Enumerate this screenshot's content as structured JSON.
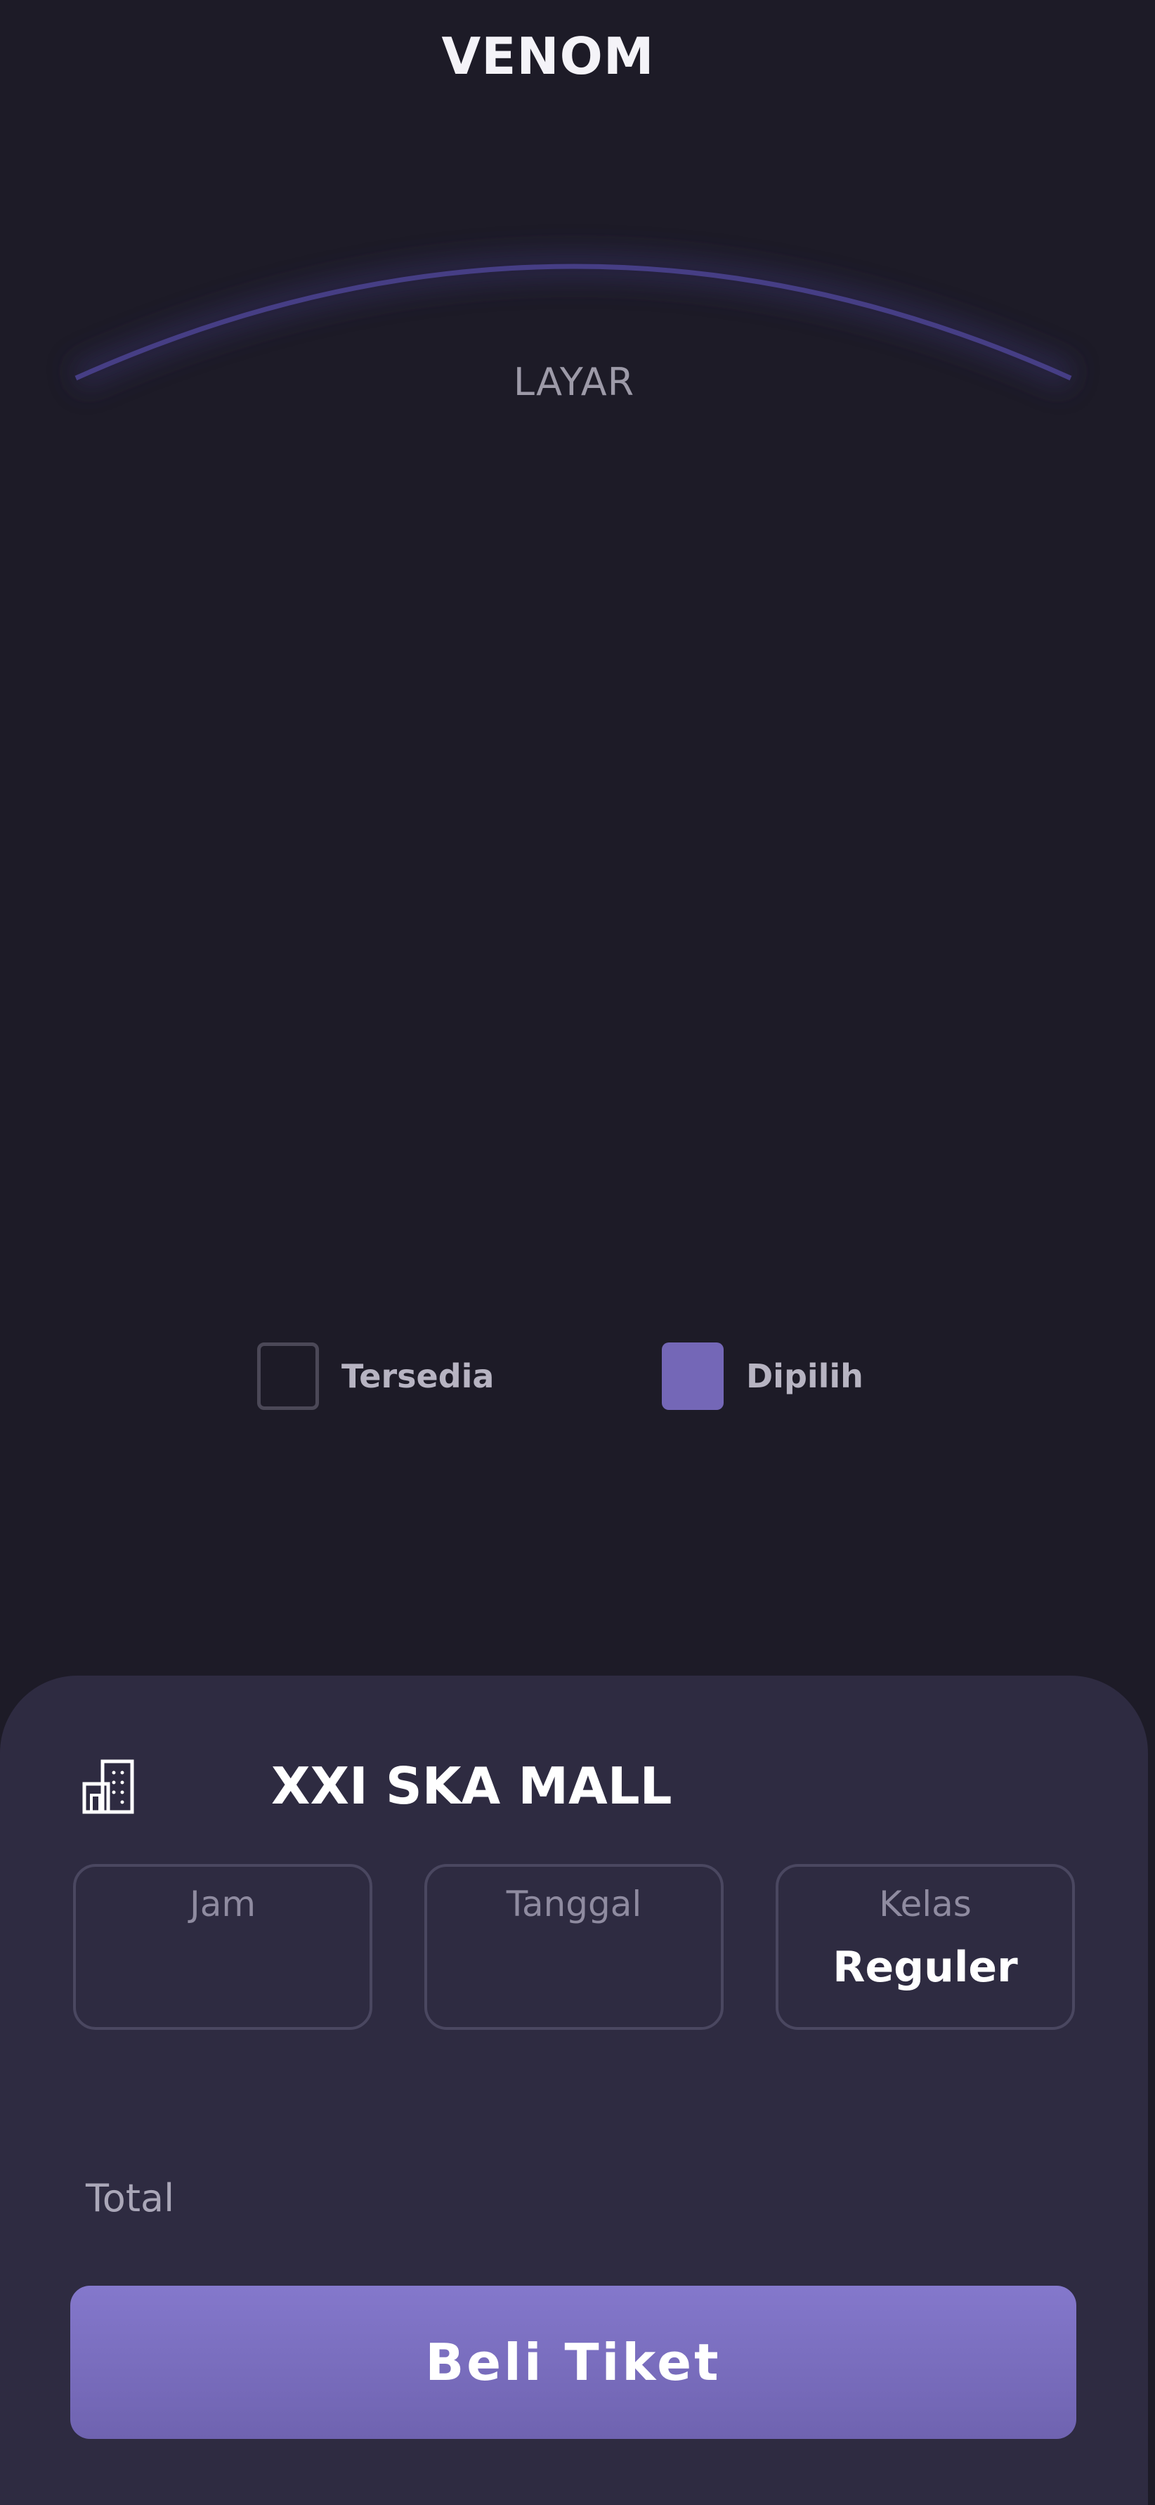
{
  "header": {
    "movie_title": "VENOM"
  },
  "screen": {
    "label": "LAYAR",
    "arc_color": "#463e85"
  },
  "legend": {
    "available_label": "Tersedia",
    "selected_label": "Dipilih",
    "available_color": "#4b4857",
    "selected_color": "#7467b7"
  },
  "booking": {
    "cinema_icon": "building-icon",
    "cinema_name": "XXI SKA MALL",
    "jam": {
      "label": "Jam",
      "value": ""
    },
    "tanggal": {
      "label": "Tanggal",
      "value": ""
    },
    "kelas": {
      "label": "Kelas",
      "value": "Reguler"
    },
    "total_label": "Total",
    "total_value": "",
    "buy_label": "Beli Tiket"
  },
  "colors": {
    "background": "#1d1b27",
    "panel": "#2e2b41",
    "accent": "#7d72c3"
  }
}
